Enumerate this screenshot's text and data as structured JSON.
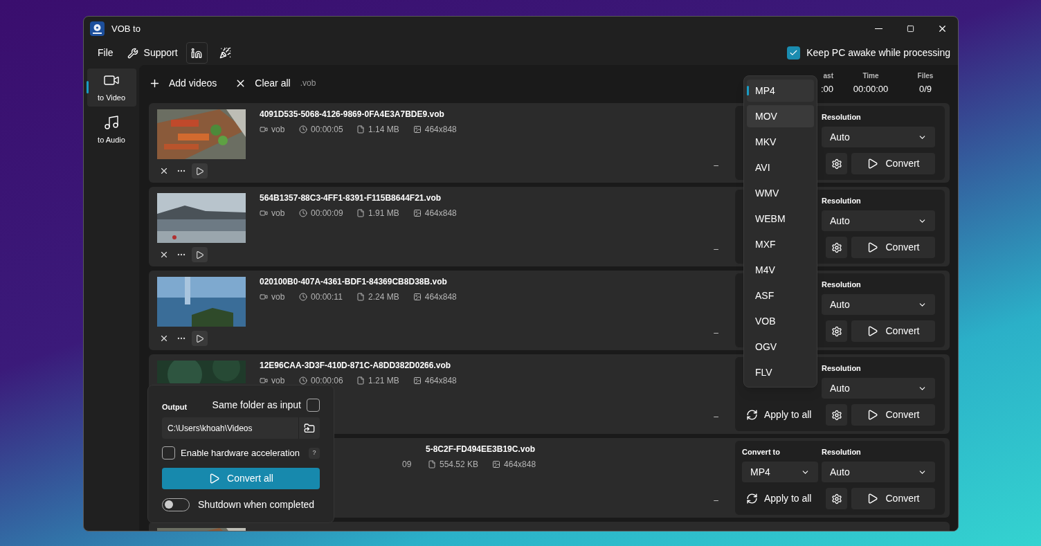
{
  "window": {
    "title": "VOB to"
  },
  "menu": {
    "items": [
      {
        "label": "File",
        "kind": "text"
      },
      {
        "label": "Support",
        "kind": "wrench"
      },
      {
        "kind": "linkedin"
      },
      {
        "kind": "party"
      }
    ],
    "keep_awake": {
      "label": "Keep PC awake while processing",
      "checked": true
    }
  },
  "sidebar": {
    "items": [
      {
        "label": "to Video",
        "kind": "video",
        "selected": true
      },
      {
        "label": "to Audio",
        "kind": "audio",
        "selected": false
      }
    ]
  },
  "toolbar": {
    "add": "Add videos",
    "clear": "Clear all",
    "filter": ".vob",
    "stats": [
      {
        "label": "ast",
        "value": ":00"
      },
      {
        "label": "Time",
        "value": "00:00:00"
      },
      {
        "label": "Files",
        "value": "0/9"
      }
    ]
  },
  "videos": [
    {
      "kind": "full",
      "name": "4091D535-5068-4126-9869-0FA4E3A7BDE9.vob",
      "format": "vob",
      "time": "00:00:05",
      "size": "1.14 MB",
      "dims": "464x848",
      "status": "–",
      "resolution_label": "Resolution",
      "resolution": "Auto",
      "convert": "Convert"
    },
    {
      "kind": "full",
      "name": "564B1357-88C3-4FF1-8391-F115B8644F21.vob",
      "format": "vob",
      "time": "00:00:09",
      "size": "1.91 MB",
      "dims": "464x848",
      "status": "–",
      "resolution_label": "Resolution",
      "resolution": "Auto",
      "convert": "Convert"
    },
    {
      "kind": "full",
      "name": "020100B0-407A-4361-BDF1-84369CB8D38B.vob",
      "format": "vob",
      "time": "00:00:11",
      "size": "2.24 MB",
      "dims": "464x848",
      "status": "–",
      "resolution_label": "Resolution",
      "resolution": "Auto",
      "convert": "Convert"
    },
    {
      "kind": "top",
      "name": "12E96CAA-3D3F-410D-871C-A8DD382D0266.vob",
      "format": "vob",
      "time": "00:00:06",
      "size": "1.21 MB",
      "dims": "464x848",
      "status": "–",
      "resolution_label": "Resolution",
      "resolution": "Auto",
      "apply": "Apply to all",
      "convert": "Convert"
    },
    {
      "kind": "covered",
      "name": "5-8C2F-FD494EE3B19C.vob",
      "time": "09",
      "size": "554.52 KB",
      "dims": "464x848",
      "status": "–",
      "convert_label": "Convert to",
      "target": "MP4",
      "resolution_label": "Resolution",
      "resolution": "Auto",
      "apply": "Apply to all",
      "convert": "Convert"
    },
    {
      "kind": "cut"
    }
  ],
  "format_menu": [
    {
      "label": "MP4",
      "selected": true,
      "hovered": false
    },
    {
      "label": "MOV",
      "selected": false,
      "hovered": true
    },
    {
      "label": "MKV",
      "selected": false,
      "hovered": false
    },
    {
      "label": "AVI",
      "selected": false,
      "hovered": false
    },
    {
      "label": "WMV",
      "selected": false,
      "hovered": false
    },
    {
      "label": "WEBM",
      "selected": false,
      "hovered": false
    },
    {
      "label": "MXF",
      "selected": false,
      "hovered": false
    },
    {
      "label": "M4V",
      "selected": false,
      "hovered": false
    },
    {
      "label": "ASF",
      "selected": false,
      "hovered": false
    },
    {
      "label": "VOB",
      "selected": false,
      "hovered": false
    },
    {
      "label": "OGV",
      "selected": false,
      "hovered": false
    },
    {
      "label": "FLV",
      "selected": false,
      "hovered": false
    }
  ],
  "output": {
    "title": "Output",
    "same_folder": {
      "label": "Same folder as input",
      "checked": false
    },
    "path": "C:\\Users\\khoah\\Videos",
    "hw_accel": {
      "label": "Enable hardware acceleration",
      "checked": false,
      "help": "?"
    },
    "convert_all": "Convert all",
    "shutdown": {
      "label": "Shutdown when completed",
      "on": false
    }
  }
}
